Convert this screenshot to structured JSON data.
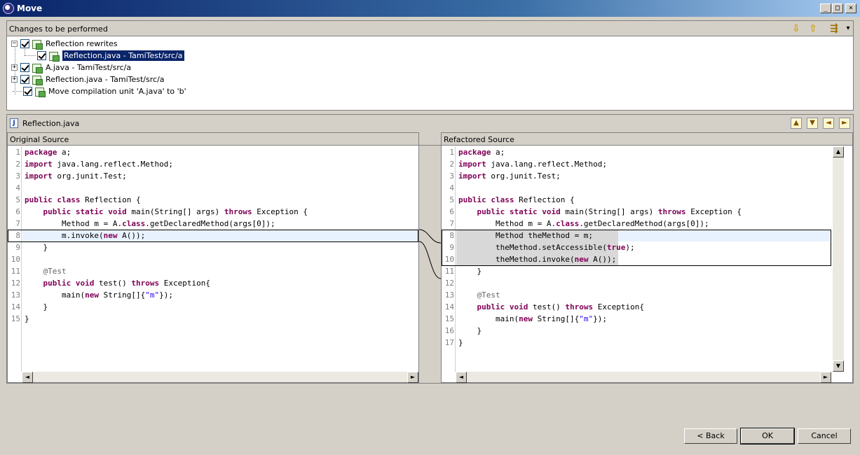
{
  "window": {
    "title": "Move",
    "minimize_glyph": "_",
    "maximize_glyph": "□",
    "close_glyph": "×"
  },
  "changes": {
    "label": "Changes to be performed",
    "tree": [
      {
        "label": "Reflection rewrites",
        "expander": "−"
      },
      {
        "label": "Reflection.java - TamiTest/src/a",
        "selected": true
      },
      {
        "label": "A.java - TamiTest/src/a",
        "expander": "+"
      },
      {
        "label": "Reflection.java - TamiTest/src/a",
        "expander": "+"
      },
      {
        "label": "Move compilation unit 'A.java' to 'b'"
      }
    ],
    "toolbar_icons": {
      "next_change": "⇩",
      "previous_change": "⇧",
      "filter": "⇶",
      "menu": "▾"
    }
  },
  "compare": {
    "file_name": "Reflection.java",
    "file_icon_glyph": "J",
    "nav_icons": [
      "▲",
      "▼",
      "◄",
      "►"
    ],
    "original_title": "Original Source",
    "refactored_title": "Refactored Source"
  },
  "original_code": {
    "line_numbers": [
      "1",
      "2",
      "3",
      "4",
      "5",
      "6",
      "7",
      "8",
      "9",
      "10",
      "11",
      "12",
      "13",
      "14",
      "15"
    ],
    "lines": [
      [
        {
          "k": "package"
        },
        {
          "t": " a;"
        }
      ],
      [
        {
          "k": "import"
        },
        {
          "t": " java.lang.reflect.Method;"
        }
      ],
      [
        {
          "k": "import"
        },
        {
          "t": " org.junit.Test;"
        }
      ],
      [],
      [
        {
          "k": "public"
        },
        {
          "t": " "
        },
        {
          "k": "class"
        },
        {
          "t": " Reflection {"
        }
      ],
      [
        {
          "t": "    "
        },
        {
          "k": "public"
        },
        {
          "t": " "
        },
        {
          "k": "static"
        },
        {
          "t": " "
        },
        {
          "k": "void"
        },
        {
          "t": " main(String[] args) "
        },
        {
          "k": "throws"
        },
        {
          "t": " Exception {"
        }
      ],
      [
        {
          "t": "        Method m = A."
        },
        {
          "k": "class"
        },
        {
          "t": ".getDeclaredMethod(args[0]);"
        }
      ],
      [
        {
          "t": "        m.invoke("
        },
        {
          "k": "new"
        },
        {
          "t": " A());"
        }
      ],
      [
        {
          "t": "    }"
        }
      ],
      [],
      [
        {
          "t": "    "
        },
        {
          "a": "@Test"
        }
      ],
      [
        {
          "t": "    "
        },
        {
          "k": "public"
        },
        {
          "t": " "
        },
        {
          "k": "void"
        },
        {
          "t": " test() "
        },
        {
          "k": "throws"
        },
        {
          "t": " Exception{"
        }
      ],
      [
        {
          "t": "        main("
        },
        {
          "k": "new"
        },
        {
          "t": " String[]{"
        },
        {
          "s": "\"m\""
        },
        {
          "t": "});"
        }
      ],
      [
        {
          "t": "    }"
        }
      ],
      [
        {
          "t": "}"
        }
      ]
    ]
  },
  "refactored_code": {
    "line_numbers": [
      "1",
      "2",
      "3",
      "4",
      "5",
      "6",
      "7",
      "8",
      "9",
      "10",
      "11",
      "12",
      "13",
      "14",
      "15",
      "16",
      "17"
    ],
    "lines": [
      [
        {
          "k": "package"
        },
        {
          "t": " a;"
        }
      ],
      [
        {
          "k": "import"
        },
        {
          "t": " java.lang.reflect.Method;"
        }
      ],
      [
        {
          "k": "import"
        },
        {
          "t": " org.junit.Test;"
        }
      ],
      [],
      [
        {
          "k": "public"
        },
        {
          "t": " "
        },
        {
          "k": "class"
        },
        {
          "t": " Reflection {"
        }
      ],
      [
        {
          "t": "    "
        },
        {
          "k": "public"
        },
        {
          "t": " "
        },
        {
          "k": "static"
        },
        {
          "t": " "
        },
        {
          "k": "void"
        },
        {
          "t": " main(String[] args) "
        },
        {
          "k": "throws"
        },
        {
          "t": " Exception {"
        }
      ],
      [
        {
          "t": "        Method m = A."
        },
        {
          "k": "class"
        },
        {
          "t": ".getDeclaredMethod(args[0]);"
        }
      ],
      [
        {
          "t": "        Method theMethod = m;"
        }
      ],
      [
        {
          "t": "        theMethod.setAccessible("
        },
        {
          "k": "true"
        },
        {
          "t": ");"
        }
      ],
      [
        {
          "t": "        theMethod.invoke("
        },
        {
          "k": "new"
        },
        {
          "t": " A());"
        }
      ],
      [
        {
          "t": "    }"
        }
      ],
      [],
      [
        {
          "t": "    "
        },
        {
          "a": "@Test"
        }
      ],
      [
        {
          "t": "    "
        },
        {
          "k": "public"
        },
        {
          "t": " "
        },
        {
          "k": "void"
        },
        {
          "t": " test() "
        },
        {
          "k": "throws"
        },
        {
          "t": " Exception{"
        }
      ],
      [
        {
          "t": "        main("
        },
        {
          "k": "new"
        },
        {
          "t": " String[]{"
        },
        {
          "s": "\"m\""
        },
        {
          "t": "});"
        }
      ],
      [
        {
          "t": "    }"
        }
      ],
      [
        {
          "t": "}"
        }
      ]
    ]
  },
  "buttons": {
    "back": "< Back",
    "ok": "OK",
    "cancel": "Cancel"
  },
  "scroll_glyphs": {
    "left": "◄",
    "right": "►",
    "up": "▲",
    "down": "▼"
  }
}
